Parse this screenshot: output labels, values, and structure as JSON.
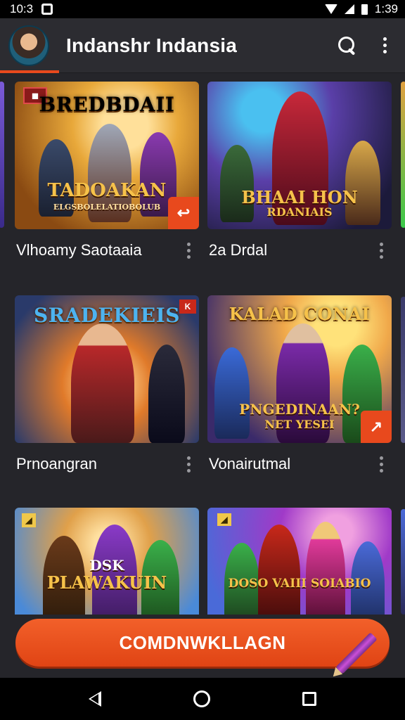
{
  "status_bar": {
    "time_left": "10:3",
    "time_right": "1:39"
  },
  "app_bar": {
    "title": "Indanshr Indansia"
  },
  "cards": [
    {
      "thumb_title": "BREDBDAII",
      "thumb_sub": "TADOAKAN",
      "thumb_sub2": "ELGSBOLELATIOBOLUB",
      "top_badge": "",
      "corner_badge": "↩",
      "title": "Vlhoamy Saotaaia",
      "colors": {
        "bg1": "#f0b84a",
        "bg2": "#8a4a12",
        "title": "#f6c24a"
      }
    },
    {
      "thumb_title": "",
      "thumb_sub": "BHAAI HON",
      "thumb_sub2": "RDANIAIS",
      "top_badge": "",
      "corner_badge": "",
      "title": "2a Drdal",
      "colors": {
        "bg1": "#5a3fa8",
        "bg2": "#1c1a3a",
        "title": "#f6c24a"
      }
    },
    {
      "thumb_title": "SRADEKIEIS",
      "thumb_sub": "",
      "thumb_sub2": "",
      "top_badge": "K",
      "corner_badge": "",
      "title": "Prnoangran",
      "colors": {
        "bg1": "#e07a2a",
        "bg2": "#2a3a6a",
        "title": "#4db3f0"
      }
    },
    {
      "thumb_title": "KALAD CONAI",
      "thumb_sub": "PNGEDINAAN?",
      "thumb_sub2": "NET YESEI",
      "top_badge": "",
      "corner_badge": "↗",
      "title": "Vonairutmal",
      "colors": {
        "bg1": "#f0c84a",
        "bg2": "#3a2a6a",
        "title": "#f6c24a"
      }
    },
    {
      "thumb_title": "",
      "thumb_sub": "PLAWAKUIN",
      "thumb_sub2": "DSK",
      "top_badge": "",
      "corner_badge": "",
      "title": "",
      "colors": {
        "bg1": "#4a8ad8",
        "bg2": "#e0a04a",
        "title": "#f6c24a"
      }
    },
    {
      "thumb_title": "",
      "thumb_sub": "DOSO VAIII SOIABIO",
      "thumb_sub2": "",
      "top_badge": "",
      "corner_badge": "",
      "title": "",
      "colors": {
        "bg1": "#4a6ad8",
        "bg2": "#a03ac8",
        "title": "#f6c24a"
      }
    }
  ],
  "cta": {
    "label": "COMDNWKLLAGN"
  }
}
